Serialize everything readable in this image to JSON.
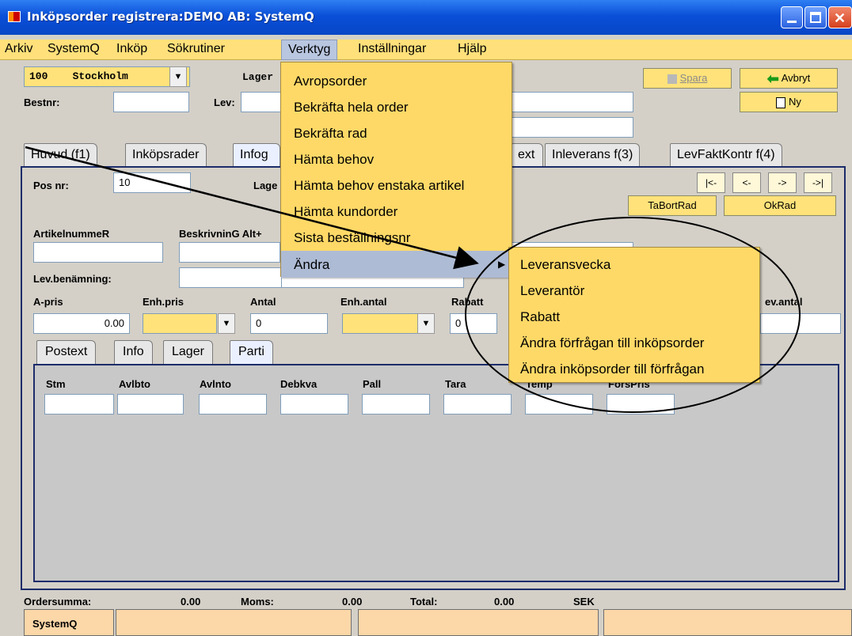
{
  "window": {
    "title": "Inköpsorder registrera:DEMO AB: SystemQ"
  },
  "menubar": {
    "items": [
      {
        "label": "Arkiv",
        "key": "A",
        "rest": "rkiv"
      },
      {
        "label": "SystemQ"
      },
      {
        "label": "Inköp"
      },
      {
        "label": "Sökrutiner"
      },
      {
        "label": "Verktyg"
      },
      {
        "label": "Inställningar"
      },
      {
        "label": "Hjälp"
      }
    ]
  },
  "header": {
    "store_code": "100",
    "store_name": "Stockholm",
    "lager_label": "Lager",
    "bestnr_label": "Bestnr:",
    "lev_label": "Lev:",
    "spara_label": "Spara",
    "avbryt_label": "Avbryt",
    "ny_label": "Ny"
  },
  "tabs": [
    "Huvud (f1)",
    "Inköpsrader",
    "Infog",
    "ext",
    "Inleverans f(3)",
    "LevFaktKontr f(4)"
  ],
  "form": {
    "posnr_label": "Pos nr:",
    "posnr_value": "10",
    "lager_label": "Lage",
    "nav_first": "|<-",
    "nav_prev": "<-",
    "nav_next": "->",
    "nav_last": "->|",
    "tabortrad": "TaBortRad",
    "okrad": "OkRad",
    "artikelnummer_label": "ArtikelnummeR",
    "beskrivning_label": "BeskrivninG Alt+",
    "levbenamning_label": "Lev.benämning:",
    "apris_label": "A-pris",
    "apris_value": "0.00",
    "enhpris_label": "Enh.pris",
    "antal_label": "Antal",
    "antal_value": "0",
    "enhantal_label": "Enh.antal",
    "rabatt_label": "Rabatt",
    "rabatt_value": "0",
    "levantal_label": "ev.antal"
  },
  "inner_tabs": [
    "Postext",
    "Info",
    "Lager",
    "Parti"
  ],
  "parti": {
    "columns": [
      "Stm",
      "Avlbto",
      "Avlnto",
      "Debkva",
      "Pall",
      "Tara",
      "Temp",
      "FörsPris"
    ]
  },
  "verktyg_menu": {
    "items": [
      "Avropsorder",
      "Bekräfta hela order",
      "Bekräfta rad",
      "Hämta behov",
      "Hämta behov enstaka artikel",
      "Hämta kundorder",
      "Sista beställningsnr",
      "Ändra"
    ]
  },
  "andra_submenu": {
    "items": [
      "Leveransvecka",
      "Leverantör",
      "Rabatt",
      "Ändra förfrågan till inköpsorder",
      "Ändra inköpsorder till förfrågan"
    ]
  },
  "statusbar": {
    "ordersumma_label": "Ordersumma:",
    "ordersumma_value": "0.00",
    "moms_label": "Moms:",
    "moms_value": "0.00",
    "total_label": "Total:",
    "total_value": "0.00",
    "currency": "SEK",
    "system_label": "SystemQ"
  }
}
